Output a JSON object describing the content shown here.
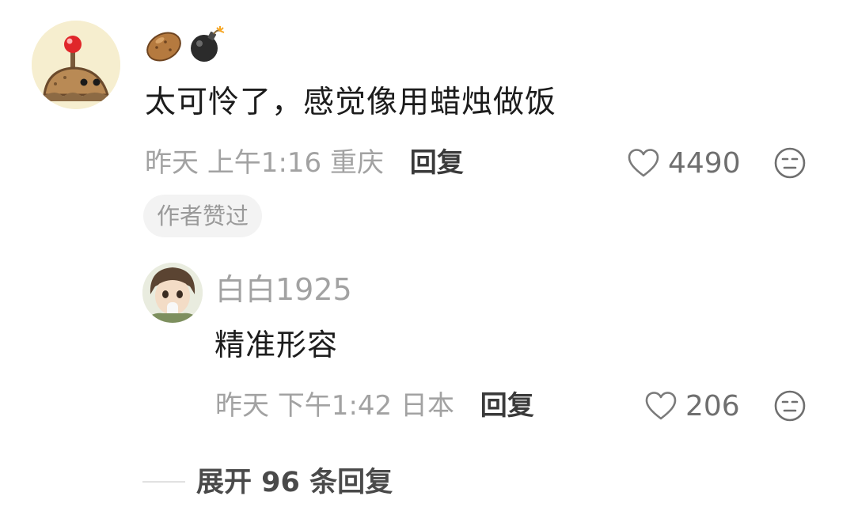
{
  "comment": {
    "text": "太可怜了，感觉像用蜡烛做饭",
    "meta": {
      "date": "昨天",
      "time": "上午1:16",
      "location": "重庆",
      "reply_label": "回复"
    },
    "likes": "4490",
    "badge": "作者赞过",
    "username_icons": [
      "potato-icon",
      "bomb-icon"
    ]
  },
  "reply": {
    "username": "白白1925",
    "text": "精准形容",
    "meta": {
      "date": "昨天",
      "time": "下午1:42",
      "location": "日本",
      "reply_label": "回复"
    },
    "likes": "206"
  },
  "expand": {
    "label": "展开 96 条回复"
  }
}
